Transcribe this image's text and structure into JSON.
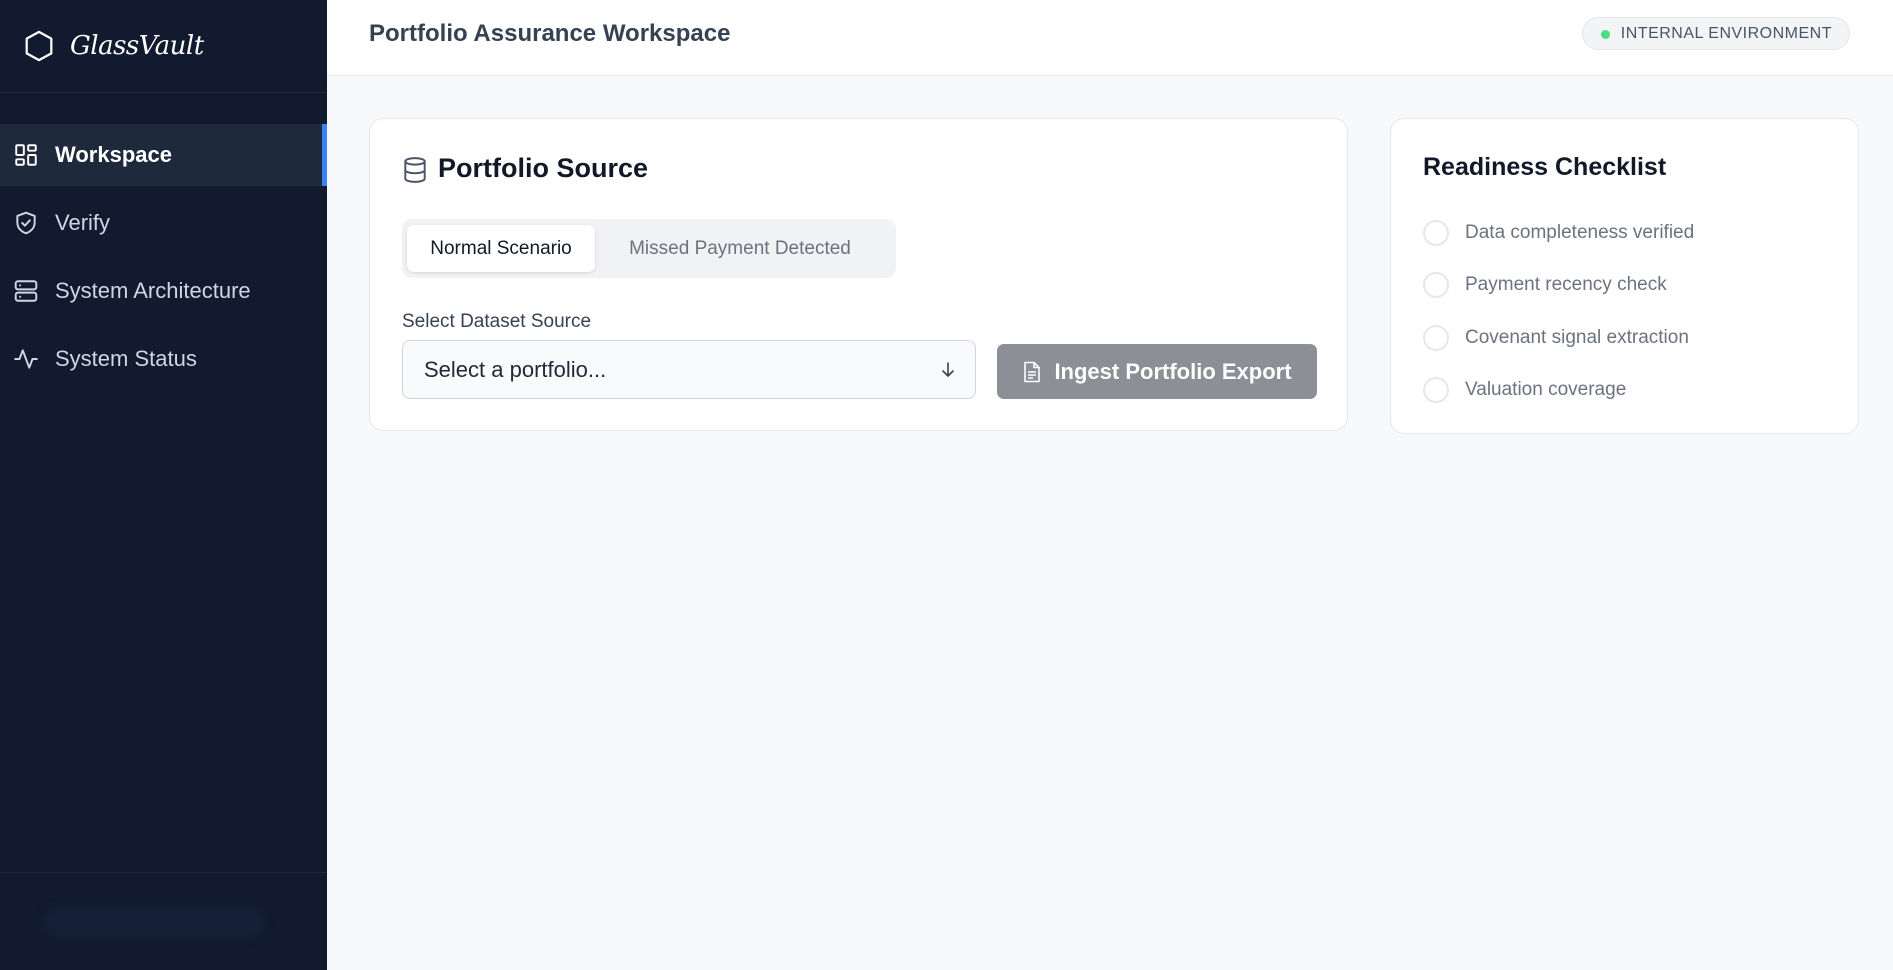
{
  "brand": {
    "name": "GlassVault",
    "logo_icon": "hexagon-icon"
  },
  "sidebar": {
    "items": [
      {
        "label": "Workspace",
        "icon": "grid-icon",
        "active": true
      },
      {
        "label": "Verify",
        "icon": "shield-check-icon",
        "active": false
      },
      {
        "label": "System Architecture",
        "icon": "server-icon",
        "active": false
      },
      {
        "label": "System Status",
        "icon": "activity-icon",
        "active": false
      }
    ]
  },
  "header": {
    "title": "Portfolio Assurance Workspace",
    "env_badge": "INTERNAL ENVIRONMENT",
    "env_status_color": "#4ade80"
  },
  "source_card": {
    "title": "Portfolio Source",
    "scenarios": [
      "Normal Scenario",
      "Missed Payment Detected"
    ],
    "selected_scenario": "Normal Scenario",
    "dataset_label": "Select Dataset Source",
    "select_placeholder": "Select a portfolio...",
    "ingest_button": "Ingest Portfolio Export"
  },
  "checklist": {
    "title": "Readiness Checklist",
    "items": [
      "Data completeness verified",
      "Payment recency check",
      "Covenant signal extraction",
      "Valuation coverage"
    ]
  },
  "colors": {
    "sidebar_bg": "#111a2e",
    "accent": "#3b82f6",
    "disabled_button": "#8c8f96"
  }
}
